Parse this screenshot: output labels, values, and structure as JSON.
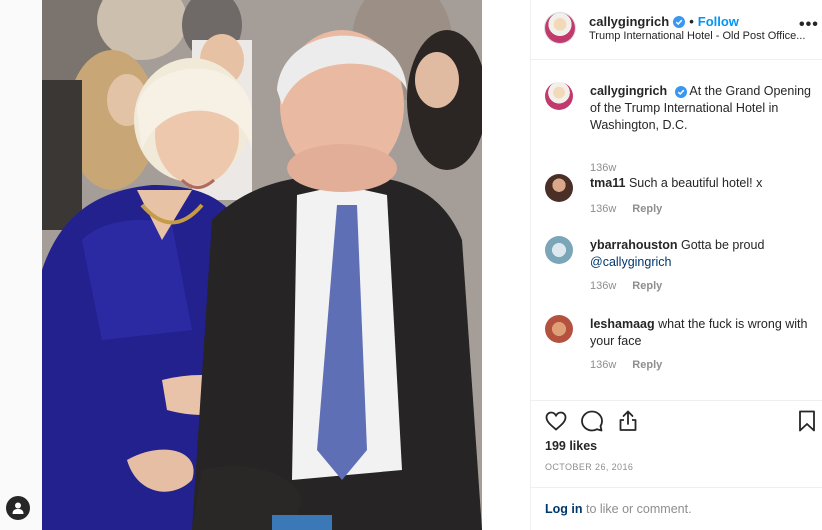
{
  "header": {
    "username": "callygingrich",
    "separator": "•",
    "follow_label": "Follow",
    "location": "Trump International Hotel - Old Post Office...",
    "more_label": "•••"
  },
  "caption": {
    "username": "callygingrich",
    "text": "At the Grand Opening of the Trump International Hotel in Washington, D.C.",
    "age": "136w"
  },
  "comments": [
    {
      "username": "tma11",
      "text": "Such a beautiful hotel! x",
      "age": "136w",
      "reply_label": "Reply"
    },
    {
      "username": "ybarrahouston",
      "text": "Gotta be proud",
      "mention": "@callygingrich",
      "age": "136w",
      "reply_label": "Reply"
    },
    {
      "username": "leshamaag",
      "text": "what the fuck is wrong with your face",
      "age": "136w",
      "reply_label": "Reply"
    }
  ],
  "post": {
    "likes": "199 likes",
    "date": "OCTOBER 26, 2016"
  },
  "login": {
    "link_label": "Log in",
    "suffix": " to like or comment."
  },
  "icons": {
    "verified": "verified-badge-icon",
    "like": "heart-icon",
    "comment": "comment-bubble-icon",
    "share": "share-icon",
    "save": "bookmark-icon",
    "profile": "profile-icon"
  },
  "colors": {
    "accent": "#0095f6",
    "mention": "#00376b",
    "muted": "#8e8e8e",
    "text": "#262626"
  }
}
